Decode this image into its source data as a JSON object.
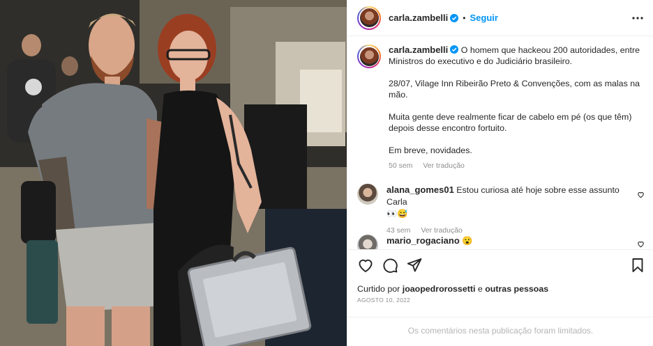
{
  "post": {
    "username": "carla.zambelli",
    "follow_label": "Seguir",
    "separator": "•"
  },
  "caption": {
    "username": "carla.zambelli",
    "line1": "O homem que hackeou 200 autoridades, entre Ministros do executivo e do Judiciário brasileiro.",
    "line2": "28/07, Vilage Inn Ribeirão Preto & Convenções, com as malas na mão.",
    "line3": "Muita gente deve realmente ficar de cabelo em pé (os que têm) depois desse encontro fortuito.",
    "line4": "Em breve, novidades.",
    "time": "50 sem",
    "translate": "Ver tradução"
  },
  "comments": [
    {
      "username": "alana_gomes01",
      "text": "Estou curiosa até hoje sobre esse assunto Carla",
      "emoji": "👀😅",
      "time": "43 sem",
      "translate": "Ver tradução"
    },
    {
      "username": "mario_rogaciano",
      "text": "😮"
    }
  ],
  "likes": {
    "prefix": "Curtido por",
    "user": "joaopedrorossetti",
    "joiner": "e",
    "others": "outras pessoas"
  },
  "date": "AGOSTO 10, 2022",
  "comments_limited": "Os comentários nesta publicação foram limitados.",
  "icons": [
    "verified-badge-icon",
    "more-options-icon",
    "heart-icon",
    "comment-icon",
    "share-icon",
    "save-icon"
  ],
  "colors": {
    "accent": "#0095f6",
    "text": "#262626",
    "muted": "#8e8e8e"
  }
}
